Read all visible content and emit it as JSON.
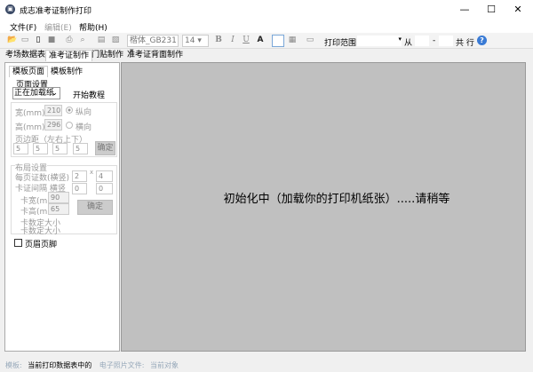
{
  "window": {
    "title": "成志准考证制作打印",
    "minimize": "—",
    "maximize": "☐",
    "close": "✕"
  },
  "menu": [
    "文件(F)",
    "编辑(E)",
    "帮助(H)"
  ],
  "toolbar": {
    "font": "楷体_GB231",
    "size": "14",
    "bold": "B",
    "italic": "I",
    "underline": "U",
    "text": "A",
    "print_range_label": "打印范围",
    "from_label": "从",
    "dash": "-",
    "total_label": "共 行",
    "help": "?"
  },
  "tabs": [
    "考场数据表",
    "准考证制作",
    "门贴制作",
    "准考证背面制作"
  ],
  "left": {
    "subtabs": [
      "模板页面",
      "模板制作"
    ],
    "page_settings": "页面设置",
    "paper_select": "正在加载纸",
    "tutorial": "开始教程",
    "width_label": "宽(mm)",
    "width": "210",
    "portrait": "纵向",
    "height_label": "高(mm)",
    "height": "296",
    "landscape": "横向",
    "margin_label": "页边距（左右上下）",
    "margins": [
      "5",
      "5",
      "5",
      "5"
    ],
    "confirm": "确定",
    "layout_settings": "布局设置",
    "per_page_label": "每页证数(横竖)",
    "cols": "2",
    "x": "x",
    "rows": "4",
    "gap_label": "卡证间隔 横竖",
    "gap_h": "0",
    "gap_v": "0",
    "card_w_label": "卡宽(mm)",
    "card_w": "90",
    "card_h_label": "卡高(mm)",
    "card_h": "65",
    "layout_confirm": "确定",
    "fixed1": "卡数定大小",
    "fixed2": "卡数定大小",
    "header_footer": "页眉页脚"
  },
  "canvas": {
    "message": "初始化中（加载你的打印机纸张）.....请稍等"
  },
  "status": {
    "template_label": "模板:",
    "template_value": "当前打印数据表中的",
    "photo_label": "电子照片文件:",
    "photo_value": "当前对象"
  }
}
